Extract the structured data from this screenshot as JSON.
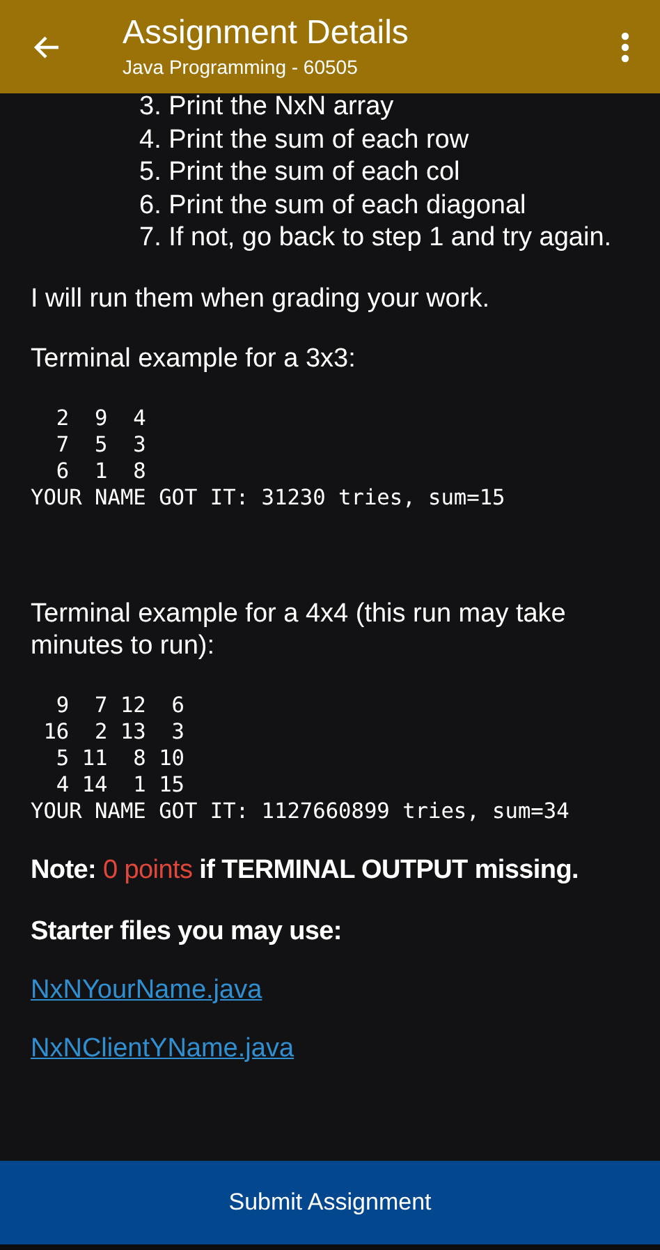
{
  "header": {
    "title": "Assignment Details",
    "subtitle": "Java Programming - 60505"
  },
  "steps": [
    "3. Print the NxN array",
    "4. Print the sum of each row",
    "5. Print the sum of each col",
    "6. Print the sum of each diagonal",
    "7. If not, go back to step 1 and try again."
  ],
  "paragraphs": [
    {
      "kind": "text",
      "text": "I will run them when grading your work."
    },
    {
      "kind": "text",
      "text": "Terminal example for a 3x3:"
    },
    {
      "kind": "terminal",
      "lines": [
        "  2  9  4",
        "  7  5  3",
        "  6  1  8",
        "YOUR NAME GOT IT: 31230 tries, sum=15"
      ]
    },
    {
      "kind": "text",
      "text": "Terminal example for a 4x4 (this run may take minutes to run):"
    },
    {
      "kind": "terminal",
      "lines": [
        "  9  7 12  6",
        " 16  2 13  3",
        "  5 11  8 10",
        "  4 14  1 15",
        "YOUR NAME GOT IT: 1127660899 tries, sum=34"
      ]
    }
  ],
  "note": {
    "parts": [
      {
        "kind": "normal",
        "text": "Note: "
      },
      {
        "kind": "alert",
        "text": "0 points"
      },
      {
        "kind": "normal",
        "text": " if TERMINAL OUTPUT missing."
      }
    ]
  },
  "starter_heading": "Starter files you may use:",
  "files": [
    "NxNYourName.java",
    "NxNClientYName.java"
  ],
  "submit_button": "Submit Assignment"
}
